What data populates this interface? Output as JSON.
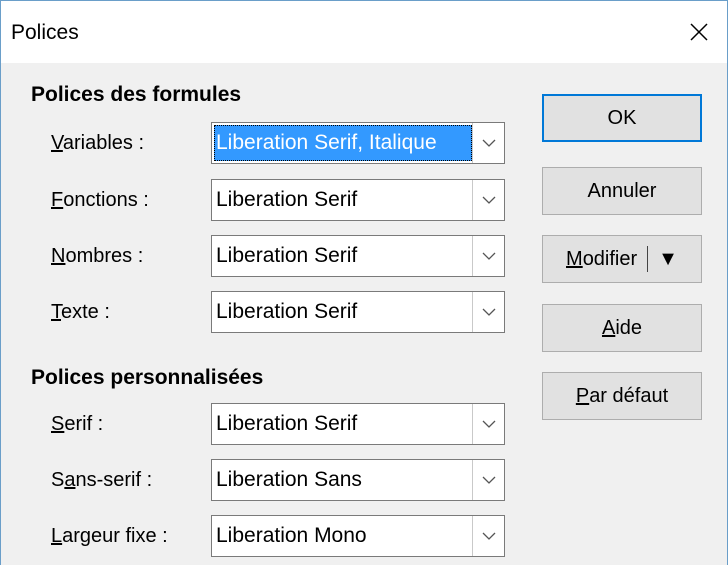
{
  "window": {
    "title": "Polices",
    "close_icon": "close-icon"
  },
  "formula_fonts": {
    "section_title": "Polices des formules",
    "rows": [
      {
        "label_u": "V",
        "label_rest": "ariables :",
        "value": "Liberation Serif, Italique",
        "selected": true
      },
      {
        "label_u": "F",
        "label_rest": "onctions :",
        "value": "Liberation Serif",
        "selected": false
      },
      {
        "label_u": "N",
        "label_rest": "ombres :",
        "value": "Liberation Serif",
        "selected": false
      },
      {
        "label_u": "T",
        "label_rest": "exte :",
        "value": "Liberation Serif",
        "selected": false
      }
    ]
  },
  "custom_fonts": {
    "section_title": "Polices personnalisées",
    "rows": [
      {
        "label_u": "S",
        "label_rest": "erif :",
        "value": "Liberation Serif",
        "selected": false
      },
      {
        "label_pre": "S",
        "label_u": "a",
        "label_rest": "ns-serif :",
        "value": "Liberation Sans",
        "selected": false
      },
      {
        "label_u": "L",
        "label_rest": "argeur fixe :",
        "value": "Liberation Mono",
        "selected": false
      }
    ]
  },
  "buttons": {
    "ok": "OK",
    "cancel": "Annuler",
    "modify_u": "M",
    "modify_rest": "odifier",
    "modify_arrow": "▼",
    "help_u": "A",
    "help_rest": "ide",
    "default_u": "P",
    "default_rest": "ar défaut"
  },
  "colors": {
    "selection": "#3399ff",
    "default_button_border": "#0078d7"
  }
}
